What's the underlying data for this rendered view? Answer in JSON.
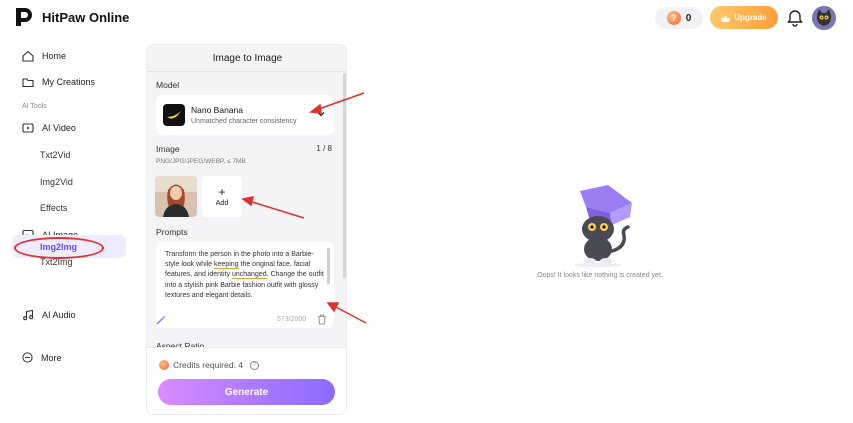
{
  "app": {
    "name": "HitPaw Online",
    "credits": "0",
    "upgrade_label": "Upgrade"
  },
  "sidebar": {
    "home": "Home",
    "my_creations": "My Creations",
    "section_label": "AI Tools",
    "ai_video": "AI Video",
    "txt2vid": "Txt2Vid",
    "img2vid": "Img2Vid",
    "effects": "Effects",
    "ai_image": "AI Image",
    "txt2img": "Txt2Img",
    "img2img": "Img2Img",
    "ai_audio": "AI Audio",
    "more": "More"
  },
  "panel": {
    "title": "Image to Image",
    "model_label": "Model",
    "model_name": "Nano Banana",
    "model_desc": "Unmatched character consistency",
    "image_label": "Image",
    "image_count": "1 / 8",
    "image_hint": "PNG/JPG/JPEG/WEBP, ≤ 7MB",
    "add_label": "Add",
    "prompts_label": "Prompts",
    "prompt_text_1": "Transform the person in the photo into a Barbie-style look while ",
    "prompt_keeping": "keeping",
    "prompt_text_2": " the original face, facial features, and identity ",
    "prompt_unchanged": "unchanged",
    "prompt_text_3": ". Change the outfit into a stylish pink Barbie fashion outfit with glossy textures and elegant details.",
    "char_count": "573/2000",
    "aspect_label": "Aspect Ratio",
    "credits_required": "Credits required: 4",
    "generate_label": "Generate"
  },
  "empty_state": {
    "message": "Oops! It looks like nothing is created yet."
  },
  "colors": {
    "accent": "#6b4bff",
    "upgrade": "#ff9f3a",
    "annotation": "#e03131"
  },
  "icons": [
    "logo-icon",
    "home-icon",
    "folder-icon",
    "video-icon",
    "image-icon",
    "music-icon",
    "more-icon",
    "bell-icon",
    "coin-icon",
    "chevron-down-icon",
    "plus-icon",
    "wand-icon",
    "trash-icon",
    "help-icon"
  ]
}
